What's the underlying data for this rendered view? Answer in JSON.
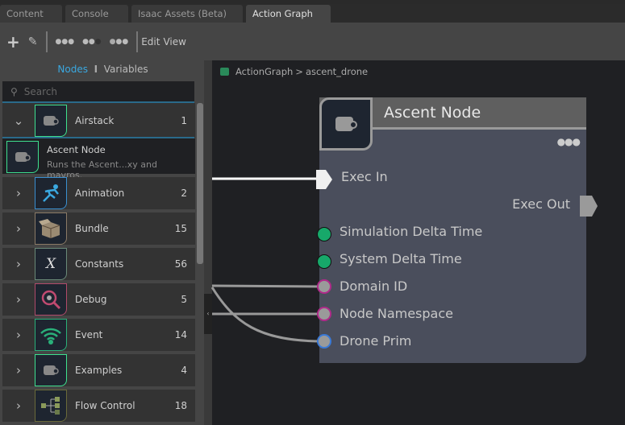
{
  "tabs": [
    {
      "label": "Content"
    },
    {
      "label": "Console"
    },
    {
      "label": "Isaac Assets (Beta)"
    },
    {
      "label": "Action Graph",
      "active": true
    }
  ],
  "toolbar": {
    "edit_label": "Edit",
    "view_label": "View"
  },
  "subtabs": {
    "nodes": "Nodes",
    "separator": "I",
    "variables": "Variables"
  },
  "search": {
    "placeholder": "Search"
  },
  "categories": [
    {
      "label": "Airstack",
      "count": "1",
      "expanded": true,
      "color": "#3ee08f",
      "icon": "node-icon"
    },
    {
      "label": "Animation",
      "count": "2",
      "color": "#3a8fd0",
      "icon": "running-man-icon"
    },
    {
      "label": "Bundle",
      "count": "15",
      "color": "#8a7a66",
      "icon": "box-icon"
    },
    {
      "label": "Constants",
      "count": "56",
      "color": "#6a8a78",
      "icon": "x-variable-icon"
    },
    {
      "label": "Debug",
      "count": "5",
      "color": "#b04a6a",
      "icon": "bug-magnifier-icon"
    },
    {
      "label": "Event",
      "count": "14",
      "color": "#2ab07a",
      "icon": "wifi-icon"
    },
    {
      "label": "Examples",
      "count": "4",
      "color": "#3ee08f",
      "icon": "node-icon"
    },
    {
      "label": "Flow Control",
      "count": "18",
      "color": "#6a6a3a",
      "icon": "flow-tree-icon"
    }
  ],
  "expanded_item": {
    "title": "Ascent Node",
    "description": "Runs the Ascent...xy and mavros."
  },
  "breadcrumb": {
    "root": "ActionGraph",
    "separator": ">",
    "current": "ascent_drone"
  },
  "node": {
    "title": "Ascent Node",
    "exec_in": "Exec In",
    "exec_out": "Exec Out",
    "inputs": [
      {
        "label": "Simulation Delta Time",
        "color": "#17a86a"
      },
      {
        "label": "System Delta Time",
        "color": "#17a86a"
      },
      {
        "label": "Domain ID",
        "color": "#b02a8a"
      },
      {
        "label": "Node Namespace",
        "color": "#b02a8a"
      },
      {
        "label": "Drone Prim",
        "color": "#3a7ad8"
      }
    ]
  }
}
